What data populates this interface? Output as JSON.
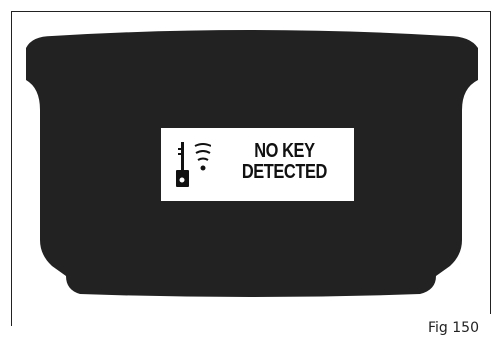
{
  "display": {
    "message_line1": "NO KEY",
    "message_line2": "DETECTED",
    "icon": "key-signal-icon"
  },
  "figure": {
    "label": "Fig 150"
  },
  "colors": {
    "display_background": "#222222",
    "message_background": "#ffffff",
    "text": "#111111"
  }
}
